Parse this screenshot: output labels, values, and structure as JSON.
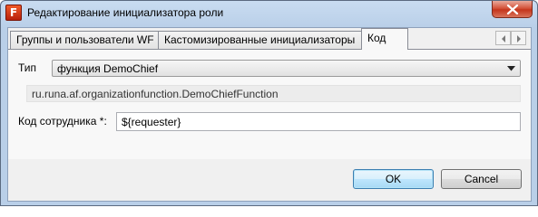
{
  "window": {
    "title": "Редактирование инициализатора роли",
    "icon": "runa-f-icon",
    "icon_letter": "F"
  },
  "tabs": [
    {
      "label": "Группы и пользователи WF",
      "active": false
    },
    {
      "label": "Кастомизированные инициализаторы",
      "active": false
    },
    {
      "label": "Код",
      "active": true
    }
  ],
  "form": {
    "type_label": "Тип",
    "type_value": "функция DemoChief",
    "class_name": "ru.runa.af.organizationfunction.DemoChiefFunction",
    "employee_code_label": "Код сотрудника *:",
    "employee_code_value": "${requester}"
  },
  "buttons": {
    "ok": "OK",
    "cancel": "Cancel"
  },
  "colors": {
    "title_gradient_top": "#c9dcf1",
    "close_button": "#c4351c",
    "default_button_border": "#3c7fb1"
  }
}
